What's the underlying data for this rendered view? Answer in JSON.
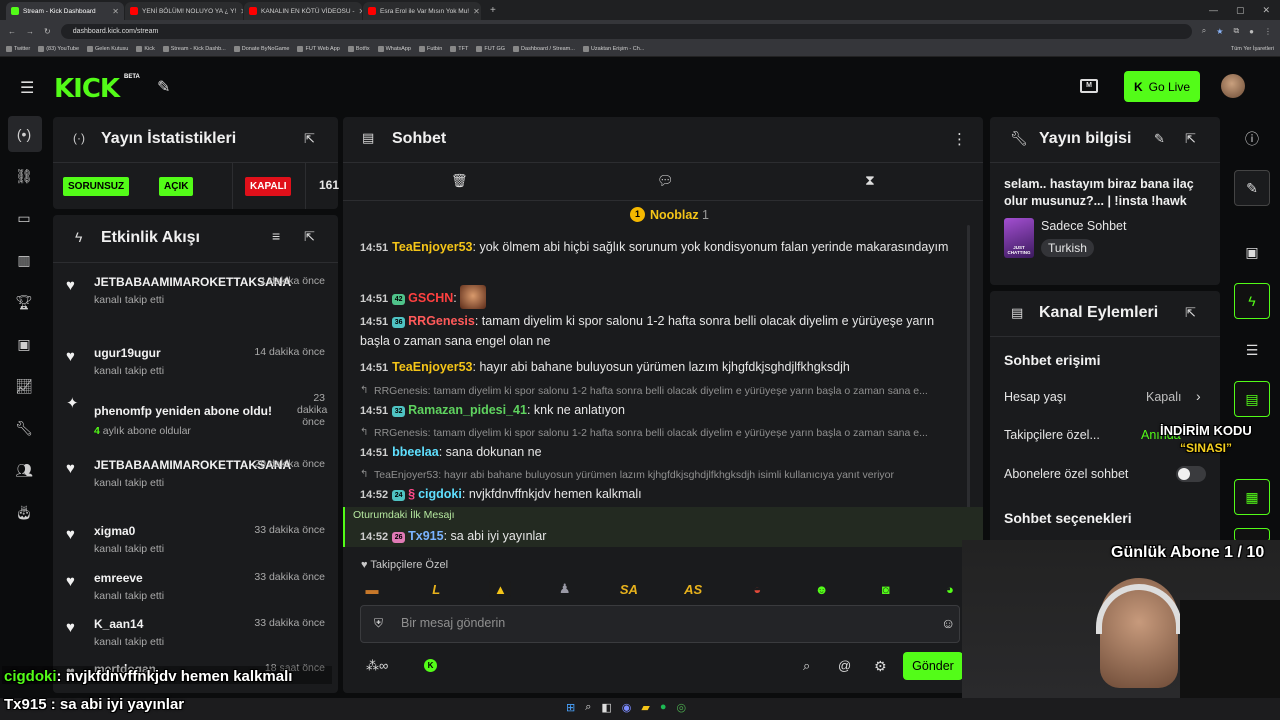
{
  "browser": {
    "tabs": [
      {
        "label": "Stream - Kick Dashboard",
        "color": "#53fc18"
      },
      {
        "label": "YENİ BÖLÜM! NOLUYO YA ¿ Y!",
        "color": "#ff0000"
      },
      {
        "label": "KANALIN EN KÖTÜ VİDEOSU -",
        "color": "#ff0000"
      },
      {
        "label": "Esra Erol ile Var Mısın Yok Mu!",
        "color": "#ff0000"
      }
    ],
    "new_tab": "+",
    "url": "dashboard.kick.com/stream",
    "bookmarks": [
      "Twitter",
      "(83) YouTube",
      "Gelen Kutusu",
      "Kick",
      "Stream - Kick Dashb...",
      "Donate ByNoGame",
      "FUT Web App",
      "Botfix",
      "WhatsApp",
      "Futbin",
      "TFT",
      "FUT GG",
      "Dashboard / Stream...",
      "Uzaktan Erişim - Ch..."
    ],
    "all_bookmarks": "Tüm Yer İşaretleri"
  },
  "header": {
    "logo": "KICK",
    "beta": "BETA",
    "go_live": "Go Live"
  },
  "stats": {
    "title": "Yayın İstatistikleri",
    "badges": [
      {
        "label": "SORUNSUZ",
        "color": "#53fc18"
      },
      {
        "label": "AÇIK",
        "color": "#53fc18"
      },
      {
        "label": "KAPALI",
        "color": "#e0101a"
      }
    ],
    "viewer_count": "161"
  },
  "activity": {
    "title": "Etkinlik Akışı",
    "items": [
      {
        "icon": "heart",
        "name": "JETBABAAMIMAROKETTAKSANA",
        "sub": "kanalı takip etti",
        "time": "1 dakika önce"
      },
      {
        "icon": "heart",
        "name": "ugur19ugur",
        "sub": "kanalı takip etti",
        "time": "14 dakika önce"
      },
      {
        "icon": "sparkle",
        "name": "phenomfp yeniden abone oldu!",
        "sub_count": "4",
        "sub": " aylık abone oldular",
        "time": "23 dakika önce"
      },
      {
        "icon": "heart",
        "name": "JETBABAAMIMAROKETTAKSANA",
        "sub": "kanalı takip etti",
        "time": "29 dakika önce"
      },
      {
        "icon": "heart",
        "name": "xigma0",
        "sub": "kanalı takip etti",
        "time": "33 dakika önce"
      },
      {
        "icon": "heart",
        "name": "emreeve",
        "sub": "kanalı takip etti",
        "time": "33 dakika önce"
      },
      {
        "icon": "heart",
        "name": "K_aan14",
        "sub": "kanalı takip etti",
        "time": "33 dakika önce"
      },
      {
        "icon": "heart",
        "name": "mertdogan",
        "sub": "",
        "time": "18 saat önce"
      }
    ]
  },
  "chat": {
    "title": "Sohbet",
    "pinned": {
      "name": "Nooblaz",
      "count": "1"
    },
    "messages": [
      {
        "time": "14:51",
        "user": "TeaEnjoyer53",
        "color": "#f5c518",
        "text": "yok ölmem abi hiçbi sağlık sorunum yok kondisyonum falan yerinde makarasındayım"
      },
      {
        "time": "14:51",
        "badge": "42",
        "badge_color": "#4fc38a",
        "user": "GSCHN",
        "color": "#ff4040",
        "text": ""
      },
      {
        "time": "14:51",
        "badge": "36",
        "badge_color": "#4fc3c3",
        "user": "RRGenesis",
        "color": "#ff5a5a",
        "text": "tamam diyelim ki spor salonu 1-2 hafta sonra belli olacak diyelim e yürüyeşe yarın başla o zaman sana engel olan ne"
      },
      {
        "time": "14:51",
        "user": "TeaEnjoyer53",
        "color": "#f5c518",
        "text": "hayır abi bahane buluyosun yürümen lazım kjhgfdkjsghdjlfkhgksdjh"
      },
      {
        "reply": "RRGenesis: tamam diyelim ki spor salonu 1-2 hafta sonra belli olacak diyelim e yürüyeşe yarın başla o zaman sana e...",
        "time": "14:51",
        "badge": "32",
        "badge_color": "#4fc3c3",
        "user": "Ramazan_pidesi_41",
        "color": "#5fd35f",
        "text": "knk ne anlatıyon"
      },
      {
        "reply": "RRGenesis: tamam diyelim ki spor salonu 1-2 hafta sonra belli olacak diyelim e yürüyeşe yarın başla o zaman sana e...",
        "time": "14:51",
        "user": "bbeelaa",
        "color": "#5fe0ff",
        "text": "sana dokunan ne"
      },
      {
        "reply": "TeaEnjoyer53: hayır abi bahane buluyosun yürümen lazım kjhgfdkjsghdjlfkhgksdjh isimli kullanıcıya yanıt veriyor",
        "time": "14:52",
        "badge": "24",
        "badge_color": "#4fc3c3",
        "user": "cigdoki",
        "color": "#5fe0ff",
        "text": "nvjkfdnvffnkjdv hemen kalkmalı"
      },
      {
        "first_label": "Oturumdaki İlk Mesajı",
        "time": "14:52",
        "badge": "26",
        "badge_color": "#e07ab5",
        "user": "Tx915",
        "color": "#7ab4ff",
        "text": "sa abi iyi yayınlar"
      }
    ],
    "emotes_label": "Takipçilere Özel",
    "input_placeholder": "Bir mesaj gönderin",
    "send": "Gönder"
  },
  "info": {
    "title": "Yayın bilgisi",
    "stream_title": "selam.. hastayım biraz bana ilaç olur musunuz?... | !insta !hawk",
    "category": "Sadece Sohbet",
    "language": "Turkish",
    "thumb_text": "JUST CHATTING"
  },
  "actions": {
    "title": "Kanal Eylemleri",
    "chat_access": "Sohbet erişimi",
    "account_age_label": "Hesap yaşı",
    "account_age_value": "Kapalı",
    "followers_only_label": "Takipçilere özel...",
    "followers_only_value": "Anında",
    "subs_only_label": "Abonelere özel sohbet",
    "chat_options": "Sohbet seçenekleri"
  },
  "overlay": {
    "promo_title": "İNDİRİM KODU",
    "promo_code": "“SINASI”",
    "daily_subs": "Günlük Abone 1 / 10",
    "chat1_user": "cigdoki",
    "chat1_text": "nvjkfdnvffnkjdv hemen kalkmalı",
    "chat2_user": "Tx915",
    "chat2_text": "sa abi iyi yayınlar"
  }
}
